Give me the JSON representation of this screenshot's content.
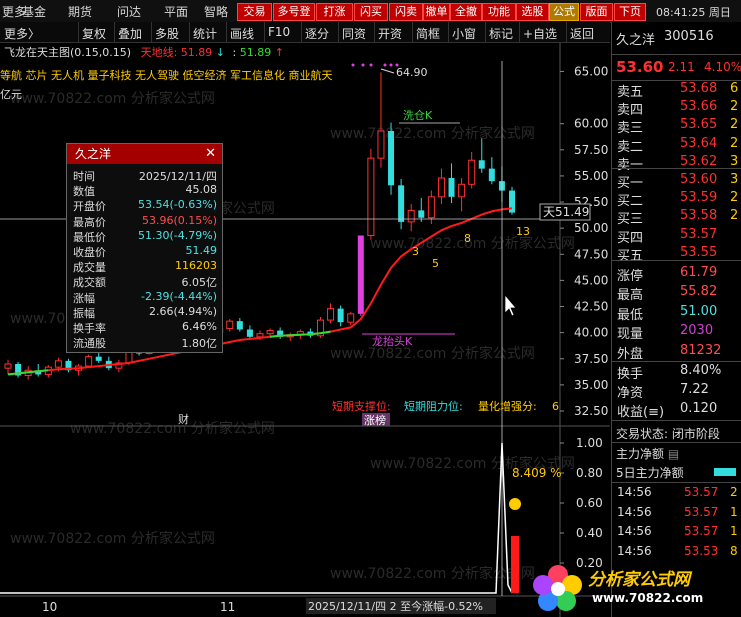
{
  "menu": {
    "items": [
      "更多",
      "基金",
      "期货",
      "问达",
      "平面",
      "智略"
    ]
  },
  "top_buttons": [
    {
      "label": "交易",
      "style": "red"
    },
    {
      "label": "多号登",
      "style": "red"
    },
    {
      "label": "打涨",
      "style": "red"
    },
    {
      "label": "闪买",
      "style": "red"
    },
    {
      "label": "闪卖",
      "style": "red"
    },
    {
      "label": "撤单",
      "style": "red"
    },
    {
      "label": "全撤",
      "style": "red"
    },
    {
      "label": "功能",
      "style": "red"
    },
    {
      "label": "选股",
      "style": "red"
    },
    {
      "label": "公式",
      "style": "yellow"
    },
    {
      "label": "版面",
      "style": "red"
    },
    {
      "label": "下页",
      "style": "red"
    }
  ],
  "clock": "08:41:25 周日",
  "toolbar": {
    "more": "更多〉",
    "items": [
      "复权",
      "叠加",
      "多股",
      "统计",
      "画线",
      "F10",
      "逐分",
      "同资",
      "开资",
      "简框",
      "小窗",
      "标记",
      "+自选",
      "返回"
    ]
  },
  "chart_title": {
    "name": "飞龙在天主图(0.15,0.15)",
    "tiandi": "天地线: 51.89",
    "arrow_down": "↓",
    "sep": ":",
    "val2": "51.89",
    "arrow_up": "↑"
  },
  "tags": "等航 芯片 无人机 量子科技 无人驾驶 低空经济 军工信息化 商业航天",
  "yuan_label": "亿元",
  "price_axis": [
    "65.00",
    "60.00",
    "57.50",
    "55.00",
    "52.50",
    "50.00",
    "47.50",
    "45.00",
    "42.50",
    "40.00",
    "37.50",
    "35.00",
    "32.50"
  ],
  "lower_axis": [
    "1.00",
    "0.80",
    "0.60",
    "0.40",
    "0.20"
  ],
  "annotations": {
    "high": "64.90",
    "xipan": "洗仓K",
    "tian": "天51.49",
    "longtai": "龙抬头K",
    "n3": "3",
    "n5": "5",
    "n8": "8",
    "n13": "13",
    "cai": "财",
    "zhangbang": "涨榜",
    "short_support": "短期支撑位: ",
    "short_resist": "短期阻力位: ",
    "quant": "量化增强分: ",
    "quant_val": "6",
    "pct": "8.409 %"
  },
  "date_axis": {
    "d10": "10",
    "d11": "11",
    "status": "2025/12/11/四 2 至今涨幅-0.52%"
  },
  "infobox": {
    "title": "久之洋",
    "rows": [
      {
        "k": "时间",
        "v": "2025/12/11/四",
        "c": "#dddddd"
      },
      {
        "k": "数值",
        "v": "45.08",
        "c": "#dddddd"
      },
      {
        "k": "开盘价",
        "v": "53.54(-0.63%)",
        "c": "#4fe0e0"
      },
      {
        "k": "最高价",
        "v": "53.96(0.15%)",
        "c": "#ff4d4d"
      },
      {
        "k": "最低价",
        "v": "51.30(-4.79%)",
        "c": "#4fe0e0"
      },
      {
        "k": "收盘价",
        "v": "51.49",
        "c": "#4fe0e0"
      },
      {
        "k": "成交量",
        "v": "116203",
        "c": "#ffcc00"
      },
      {
        "k": "成交额",
        "v": "6.05亿",
        "c": "#dddddd"
      },
      {
        "k": "涨幅",
        "v": "-2.39(-4.44%)",
        "c": "#4fe0e0"
      },
      {
        "k": "振幅",
        "v": "2.66(4.94%)",
        "c": "#dddddd"
      },
      {
        "k": "换手率",
        "v": "6.46%",
        "c": "#dddddd"
      },
      {
        "k": "流通股",
        "v": "1.80亿",
        "c": "#dddddd"
      }
    ]
  },
  "right_panel": {
    "name": "久之洋",
    "code": "300516",
    "price": "53.60",
    "change": "2.11",
    "change_pct": "4.10%",
    "sell": [
      {
        "k": "卖五",
        "p": "53.68",
        "q": "6"
      },
      {
        "k": "卖四",
        "p": "53.66",
        "q": "2"
      },
      {
        "k": "卖三",
        "p": "53.65",
        "q": "2"
      },
      {
        "k": "卖二",
        "p": "53.64",
        "q": "2"
      },
      {
        "k": "卖一",
        "p": "53.62",
        "q": "3"
      }
    ],
    "buy": [
      {
        "k": "买一",
        "p": "53.60",
        "q": "3"
      },
      {
        "k": "买二",
        "p": "53.59",
        "q": "2"
      },
      {
        "k": "买三",
        "p": "53.58",
        "q": "2"
      },
      {
        "k": "买四",
        "p": "53.57",
        "q": ""
      },
      {
        "k": "买五",
        "p": "53.55",
        "q": ""
      }
    ],
    "stats": [
      {
        "k": "涨停",
        "v": "61.79",
        "c": "#ff4d4d"
      },
      {
        "k": "最高",
        "v": "55.82",
        "c": "#ff4d4d"
      },
      {
        "k": "最低",
        "v": "51.00",
        "c": "#4fe0e0"
      },
      {
        "k": "现量",
        "v": "2030",
        "c": "#d040d0"
      },
      {
        "k": "外盘",
        "v": "81232",
        "c": "#ff4d4d"
      }
    ],
    "stats2": [
      {
        "k": "换手",
        "v": "8.40%",
        "c": "#dddddd"
      },
      {
        "k": "净资",
        "v": "7.22",
        "c": "#dddddd"
      },
      {
        "k": "收益(≡)",
        "v": "0.120",
        "c": "#dddddd"
      }
    ],
    "trade_status": "交易状态: 闭市阶段",
    "legend1": "主力净额",
    "legend2": "5日主力净额",
    "ticks": [
      {
        "t": "14:56",
        "p": "53.57",
        "q": "2"
      },
      {
        "t": "14:56",
        "p": "53.57",
        "q": "1"
      },
      {
        "t": "14:56",
        "p": "53.57",
        "q": "1"
      },
      {
        "t": "14:56",
        "p": "53.53",
        "q": "8"
      }
    ]
  },
  "watermark": "www.70822.com 分析家公式网",
  "logo": {
    "line1": "分析家公式网",
    "line2": "www.70822.com"
  },
  "colors": {
    "up": "#ff3030",
    "down": "#33dddd",
    "ma": "#ff1a1a",
    "accent_magenta": "#e040e0",
    "bg": "#000000"
  },
  "chart_data": {
    "type": "candlestick",
    "ylim": [
      32.5,
      66.0
    ],
    "candles": [
      [
        36.6,
        37.4,
        36.0,
        37.0
      ],
      [
        37.0,
        37.2,
        35.7,
        35.9
      ],
      [
        35.9,
        36.8,
        35.5,
        36.4
      ],
      [
        36.4,
        37.0,
        35.8,
        36.0
      ],
      [
        36.0,
        36.9,
        35.7,
        36.7
      ],
      [
        36.7,
        37.6,
        36.3,
        37.3
      ],
      [
        37.3,
        37.5,
        36.2,
        36.4
      ],
      [
        36.4,
        37.0,
        35.9,
        36.8
      ],
      [
        36.8,
        37.9,
        36.6,
        37.7
      ],
      [
        37.7,
        38.3,
        37.1,
        37.3
      ],
      [
        37.3,
        37.7,
        36.4,
        36.6
      ],
      [
        36.6,
        37.4,
        36.2,
        37.1
      ],
      [
        37.1,
        38.6,
        36.9,
        38.4
      ],
      [
        38.4,
        39.2,
        37.8,
        38.0
      ],
      [
        38.0,
        39.6,
        37.9,
        39.4
      ],
      [
        39.4,
        39.7,
        38.4,
        38.6
      ],
      [
        38.6,
        39.3,
        38.2,
        39.0
      ],
      [
        39.0,
        40.1,
        38.8,
        39.9
      ],
      [
        39.9,
        40.2,
        39.0,
        39.2
      ],
      [
        39.2,
        40.8,
        39.0,
        40.6
      ],
      [
        40.6,
        41.2,
        39.8,
        40.0
      ],
      [
        40.0,
        40.6,
        39.4,
        40.4
      ],
      [
        40.4,
        41.3,
        40.1,
        41.1
      ],
      [
        41.1,
        41.4,
        40.1,
        40.3
      ],
      [
        40.3,
        40.7,
        39.4,
        39.6
      ],
      [
        39.6,
        40.2,
        39.3,
        39.9
      ],
      [
        39.9,
        40.4,
        39.5,
        40.2
      ],
      [
        40.2,
        40.5,
        39.4,
        39.6
      ],
      [
        39.6,
        40.0,
        39.2,
        39.8
      ],
      [
        39.8,
        40.3,
        39.4,
        40.1
      ],
      [
        40.1,
        40.4,
        39.5,
        39.7
      ],
      [
        39.7,
        41.5,
        39.5,
        41.2
      ],
      [
        41.2,
        42.8,
        40.9,
        42.3
      ],
      [
        42.3,
        42.6,
        40.6,
        41.0
      ],
      [
        41.0,
        42.0,
        40.7,
        41.8
      ],
      [
        41.8,
        49.3,
        41.6,
        49.3
      ],
      [
        49.3,
        57.6,
        48.9,
        56.7
      ],
      [
        56.7,
        64.9,
        55.8,
        59.3
      ],
      [
        59.3,
        60.1,
        53.2,
        54.1
      ],
      [
        54.1,
        54.7,
        49.9,
        50.6
      ],
      [
        50.6,
        52.3,
        49.7,
        51.7
      ],
      [
        51.7,
        52.9,
        50.6,
        51.0
      ],
      [
        51.0,
        53.6,
        50.4,
        53.0
      ],
      [
        53.0,
        55.7,
        52.3,
        54.8
      ],
      [
        54.8,
        56.2,
        52.4,
        53.0
      ],
      [
        53.0,
        54.8,
        51.6,
        54.2
      ],
      [
        54.2,
        57.3,
        53.8,
        56.5
      ],
      [
        56.5,
        58.6,
        55.3,
        55.7
      ],
      [
        55.7,
        56.8,
        54.2,
        54.5
      ],
      [
        54.5,
        55.9,
        52.5,
        53.6
      ],
      [
        53.6,
        53.96,
        51.3,
        51.49
      ]
    ],
    "ma": [
      36.0,
      36.1,
      36.2,
      36.3,
      36.4,
      36.5,
      36.55,
      36.6,
      36.7,
      36.8,
      36.9,
      37.0,
      37.1,
      37.3,
      37.5,
      37.7,
      37.9,
      38.1,
      38.3,
      38.5,
      38.7,
      38.9,
      39.1,
      39.3,
      39.4,
      39.5,
      39.6,
      39.7,
      39.75,
      39.8,
      39.85,
      39.95,
      40.1,
      40.3,
      40.5,
      41.3,
      42.8,
      44.6,
      46.2,
      47.3,
      48.0,
      48.6,
      49.2,
      49.8,
      50.2,
      50.5,
      50.9,
      51.3,
      51.6,
      51.8,
      51.9
    ],
    "indicator": [
      0,
      0,
      0,
      0,
      0,
      0,
      0,
      0,
      0,
      0,
      0,
      0,
      0,
      0,
      0,
      0,
      0,
      0,
      0,
      0,
      0,
      0,
      0,
      0,
      0,
      0,
      0,
      0,
      0,
      0,
      0,
      0,
      0,
      0,
      0,
      0,
      0,
      0,
      0,
      0,
      0,
      0,
      0,
      0,
      0,
      0,
      0,
      0,
      0,
      1.0,
      0.08409
    ]
  }
}
